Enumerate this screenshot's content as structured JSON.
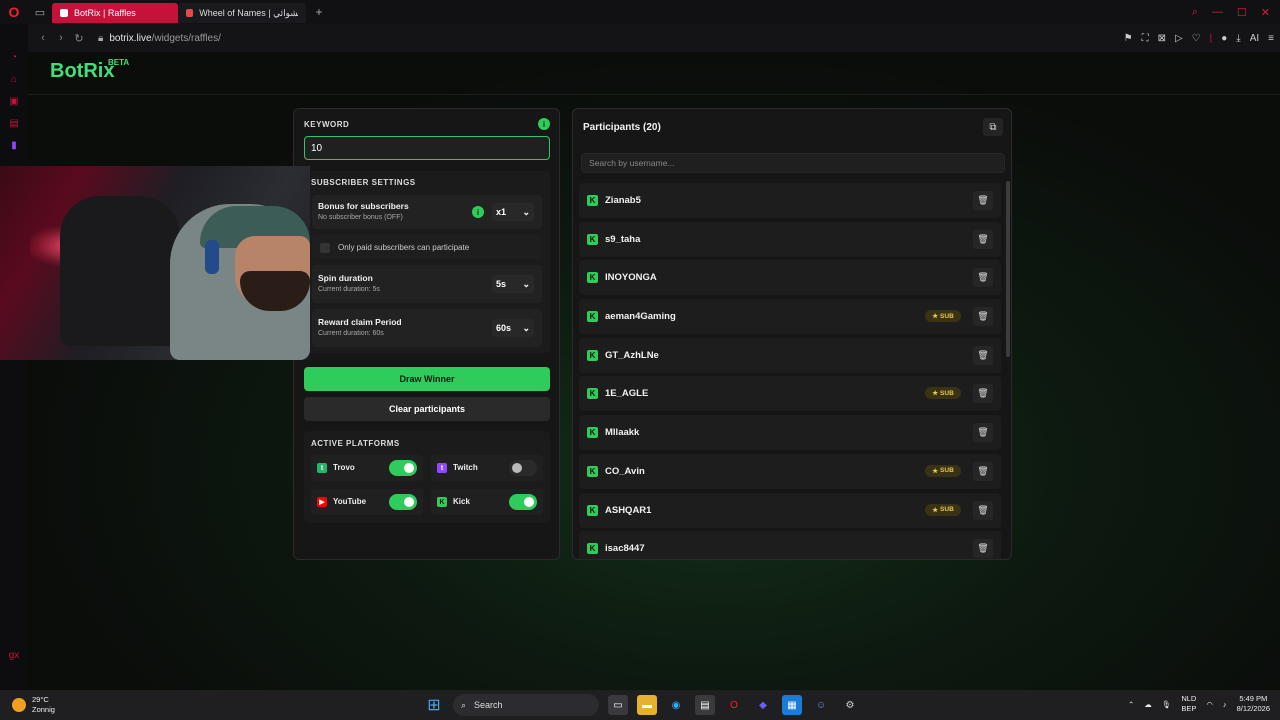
{
  "browser": {
    "tabs": [
      {
        "label": "BotRix | Raffles",
        "active": true
      },
      {
        "label": "Wheel of Names | العشوائي",
        "active": false
      }
    ],
    "url_host": "botrix.live",
    "url_path": "/widgets/raffles/",
    "ai_label": "AI"
  },
  "brand": {
    "name": "BotRix",
    "badge": "BETA"
  },
  "keyword": {
    "label": "KEYWORD",
    "value": "10"
  },
  "subscriber_settings": {
    "title": "SUBSCRIBER SETTINGS",
    "bonus_title": "Bonus for subscribers",
    "bonus_sub": "No subscriber bonus (OFF)",
    "bonus_value": "x1",
    "paid_only_label": "Only paid subscribers can participate",
    "spin_title": "Spin duration",
    "spin_sub": "Current duration: 5s",
    "spin_value": "5s",
    "reward_title": "Reward claim Period",
    "reward_sub": "Current duration: 60s",
    "reward_value": "60s"
  },
  "buttons": {
    "draw": "Draw Winner",
    "clear": "Clear participants"
  },
  "platforms": {
    "title": "ACTIVE PLATFORMS",
    "items": [
      {
        "name": "Trovo",
        "on": true,
        "color": "#1fb86a"
      },
      {
        "name": "Twitch",
        "on": false,
        "color": "#9146ff"
      },
      {
        "name": "YouTube",
        "on": true,
        "color": "#ff0000"
      },
      {
        "name": "Kick",
        "on": true,
        "color": "#53fc18"
      }
    ]
  },
  "participants": {
    "title": "Participants (20)",
    "search_placeholder": "Search by username...",
    "sub_badge": "SUB",
    "list": [
      {
        "name": "Zianab5",
        "sub": false
      },
      {
        "name": "s9_taha",
        "sub": false
      },
      {
        "name": "INOYONGA",
        "sub": false
      },
      {
        "name": "aeman4Gaming",
        "sub": true
      },
      {
        "name": "GT_AzhLNe",
        "sub": false
      },
      {
        "name": "1E_AGLE",
        "sub": true
      },
      {
        "name": "Mllaakk",
        "sub": false
      },
      {
        "name": "CO_Avin",
        "sub": true
      },
      {
        "name": "ASHQAR1",
        "sub": true
      },
      {
        "name": "isac8447",
        "sub": false
      }
    ]
  },
  "taskbar": {
    "temp": "29°C",
    "weather": "Zonnig",
    "search": "Search",
    "lang1": "NLD",
    "lang2": "BEP",
    "time": "5:49 PM",
    "date": "8/12/2026"
  },
  "colors": {
    "accent": "#2ecc5a",
    "tab_active": "#c6123a"
  }
}
